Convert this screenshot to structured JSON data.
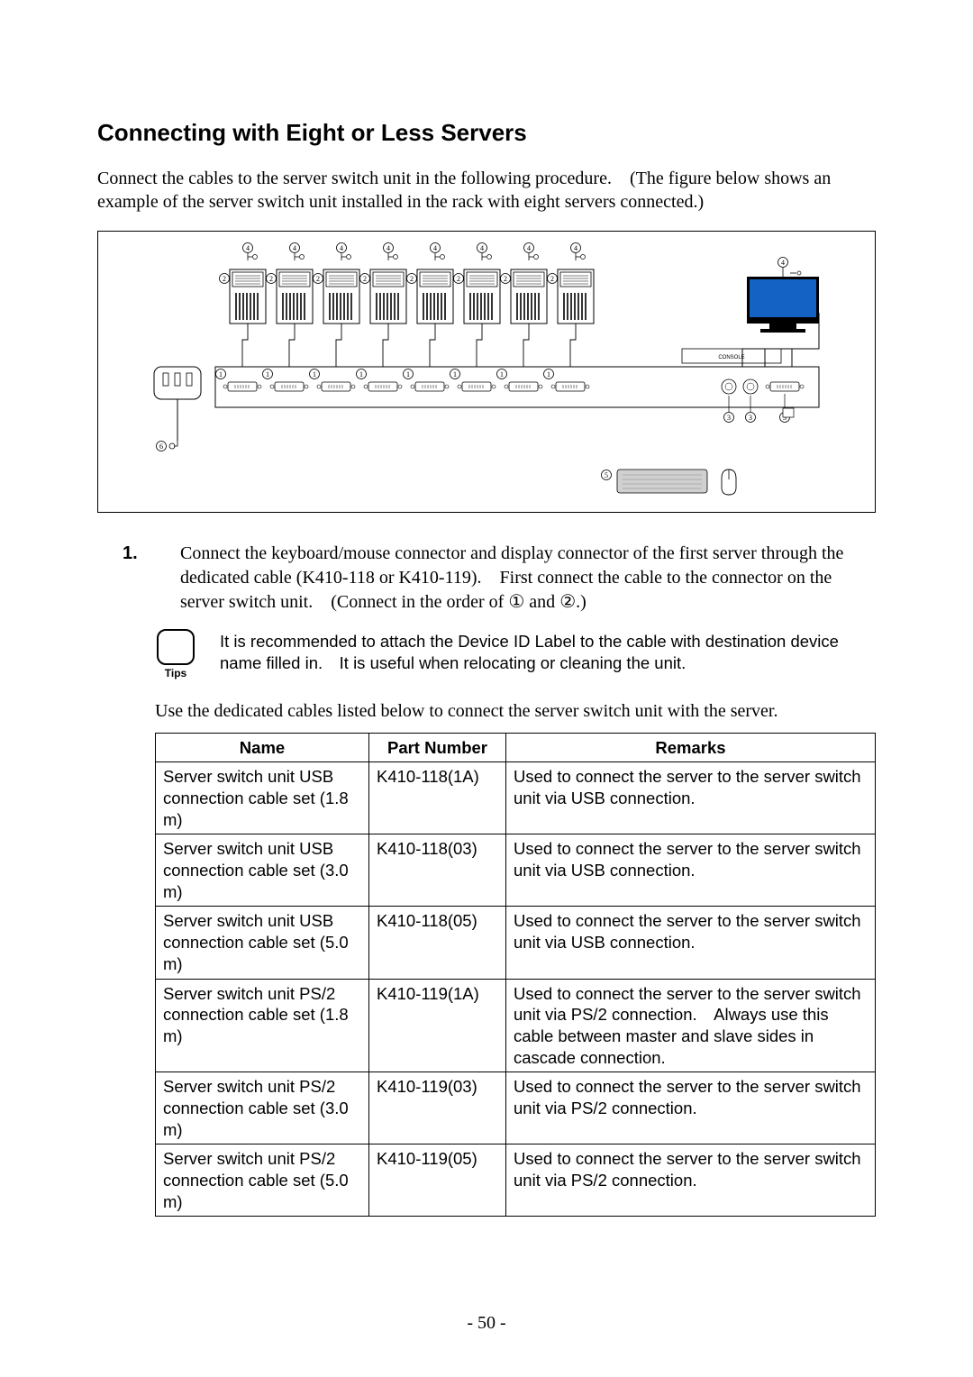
{
  "title": "Connecting with Eight or Less Servers",
  "intro": "Connect the cables to the server switch unit in the following procedure. (The figure below shows an example of the server switch unit installed in the rack with eight servers connected.)",
  "step_number": "1.",
  "step_text": "Connect the keyboard/mouse connector and display connector of the first server through the dedicated cable (K410-118 or K410-119). First connect the cable to the connector on the server switch unit. (Connect in the order of ① and ②.)",
  "tips_label": "Tips",
  "tips_text": "It is recommended to attach the Device ID Label to the cable with destination device name filled in. It is useful when relocating or cleaning the unit.",
  "lead": "Use the dedicated cables listed below to connect the server switch unit with the server.",
  "table": {
    "headers": {
      "name": "Name",
      "part": "Part Number",
      "remarks": "Remarks"
    },
    "rows": [
      {
        "name": "Server switch unit USB connection cable set (1.8 m)",
        "part": "K410-118(1A)",
        "remarks": "Used to connect the server to the server switch unit via USB connection."
      },
      {
        "name": "Server switch unit USB connection cable set (3.0 m)",
        "part": "K410-118(03)",
        "remarks": "Used to connect the server to the server switch unit via USB connection."
      },
      {
        "name": "Server switch unit USB connection cable set (5.0 m)",
        "part": "K410-118(05)",
        "remarks": "Used to connect the server to the server switch unit via USB connection."
      },
      {
        "name": "Server switch unit PS/2 connection cable set (1.8 m)",
        "part": "K410-119(1A)",
        "remarks": "Used to connect the server to the server switch unit via PS/2 connection. Always use this cable between master and slave sides in cascade connection."
      },
      {
        "name": "Server switch unit PS/2 connection cable set (3.0 m)",
        "part": "K410-119(03)",
        "remarks": "Used to connect the server to the server switch unit via PS/2 connection."
      },
      {
        "name": "Server switch unit PS/2 connection cable set (5.0 m)",
        "part": "K410-119(05)",
        "remarks": "Used to connect the server to the server switch unit via PS/2 connection."
      }
    ]
  },
  "figure": {
    "callouts": [
      "1",
      "2",
      "3",
      "4",
      "5",
      "6"
    ]
  },
  "page_number": "- 50 -"
}
